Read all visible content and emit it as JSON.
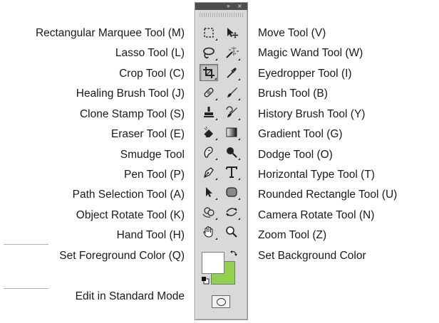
{
  "left_labels": [
    "Rectangular Marquee Tool (M)",
    "Lasso Tool (L)",
    "Crop Tool (C)",
    "Healing Brush Tool (J)",
    "Clone Stamp Tool (S)",
    "Eraser Tool (E)",
    "Smudge Tool",
    "Pen Tool (P)",
    "Path Selection Tool (A)",
    "Object Rotate Tool (K)",
    "Hand Tool (H)",
    "Set Foreground Color (Q)",
    "Edit in Standard Mode"
  ],
  "right_labels": [
    "Move Tool (V)",
    "Magic Wand Tool (W)",
    "Eyedropper Tool (I)",
    "Brush Tool (B)",
    "History Brush Tool (Y)",
    "Gradient Tool (G)",
    "Dodge Tool (O)",
    "Horizontal Type Tool (T)",
    "Rounded Rectangle Tool (U)",
    "Camera Rotate Tool (N)",
    "Zoom Tool (Z)",
    "Set Background Color"
  ],
  "toolbox": {
    "header_collapse": "»",
    "header_close": "×",
    "active_tool": "crop-tool",
    "foreground_color": "#ffffff",
    "background_color": "#92d050"
  }
}
